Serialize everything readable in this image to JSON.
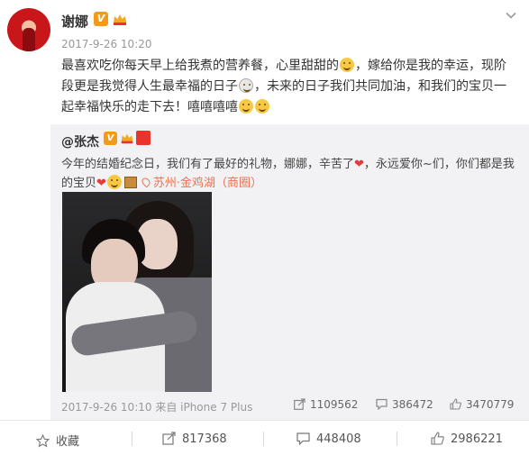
{
  "post": {
    "author": "谢娜",
    "timestamp": "2017-9-26 10:20",
    "text_parts": [
      "最喜欢吃你每天早上给我煮的营养餐，心里甜甜的",
      "，嫁给你是我的幸运，现阶段更是我觉得人生最幸福的日子",
      "，未来的日子我们共同加油，和我们的宝贝一起幸福快乐的走下去！嘻嘻嘻嘻"
    ]
  },
  "repost": {
    "author": "@张杰",
    "text_part1": "今年的结婚纪念日，我们有了最好的礼物，娜娜，辛苦了",
    "text_part2": "，永远爱你~们，你们都是我的宝贝",
    "location": "苏州·金鸡湖（商圈）",
    "timestamp": "2017-9-26 10:10 来自 iPhone 7 Plus",
    "reposts": "1109562",
    "comments": "386472",
    "likes": "3470779"
  },
  "actions": {
    "favorite": "收藏",
    "repost": "817368",
    "comment": "448408",
    "like": "2986221"
  },
  "colors": {
    "orange_badge": "#f29a1b",
    "location": "#eb7350",
    "repost_bg": "#f2f2f5"
  }
}
